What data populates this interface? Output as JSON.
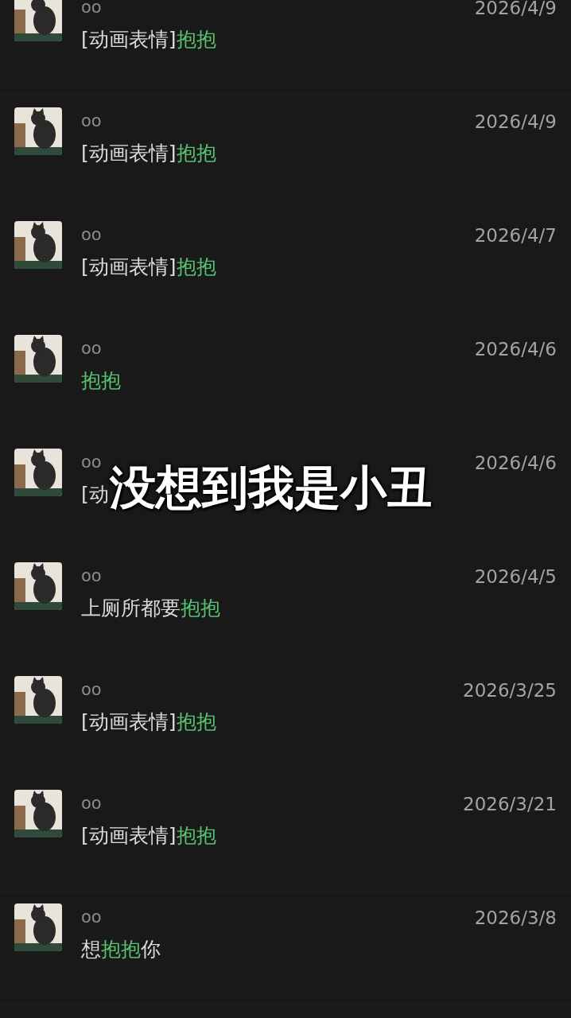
{
  "results": [
    {
      "name": "oo",
      "date": "2026/4/9",
      "message": [
        {
          "text": "[动画表情]",
          "highlight": false
        },
        {
          "text": "抱抱",
          "highlight": true
        }
      ]
    },
    {
      "name": "oo",
      "date": "2026/4/9",
      "message": [
        {
          "text": "[动画表情]",
          "highlight": false
        },
        {
          "text": "抱抱",
          "highlight": true
        }
      ]
    },
    {
      "name": "oo",
      "date": "2026/4/7",
      "message": [
        {
          "text": "[动画表情]",
          "highlight": false
        },
        {
          "text": "抱抱",
          "highlight": true
        }
      ]
    },
    {
      "name": "oo",
      "date": "2026/4/6",
      "message": [
        {
          "text": "抱抱",
          "highlight": true
        }
      ]
    },
    {
      "name": "oo",
      "date": "2026/4/6",
      "message": [
        {
          "text": "[动",
          "highlight": false
        }
      ]
    },
    {
      "name": "oo",
      "date": "2026/4/5",
      "message": [
        {
          "text": "上厕所都要",
          "highlight": false
        },
        {
          "text": "抱抱",
          "highlight": true
        }
      ]
    },
    {
      "name": "oo",
      "date": "2026/3/25",
      "message": [
        {
          "text": "[动画表情]",
          "highlight": false
        },
        {
          "text": "抱抱",
          "highlight": true
        }
      ]
    },
    {
      "name": "oo",
      "date": "2026/3/21",
      "message": [
        {
          "text": "[动画表情]",
          "highlight": false
        },
        {
          "text": "抱抱",
          "highlight": true
        }
      ]
    },
    {
      "name": "oo",
      "date": "2026/3/8",
      "message": [
        {
          "text": "想",
          "highlight": false
        },
        {
          "text": "抱抱",
          "highlight": true
        },
        {
          "text": "你",
          "highlight": false
        }
      ]
    }
  ],
  "caption": "没想到我是小丑"
}
